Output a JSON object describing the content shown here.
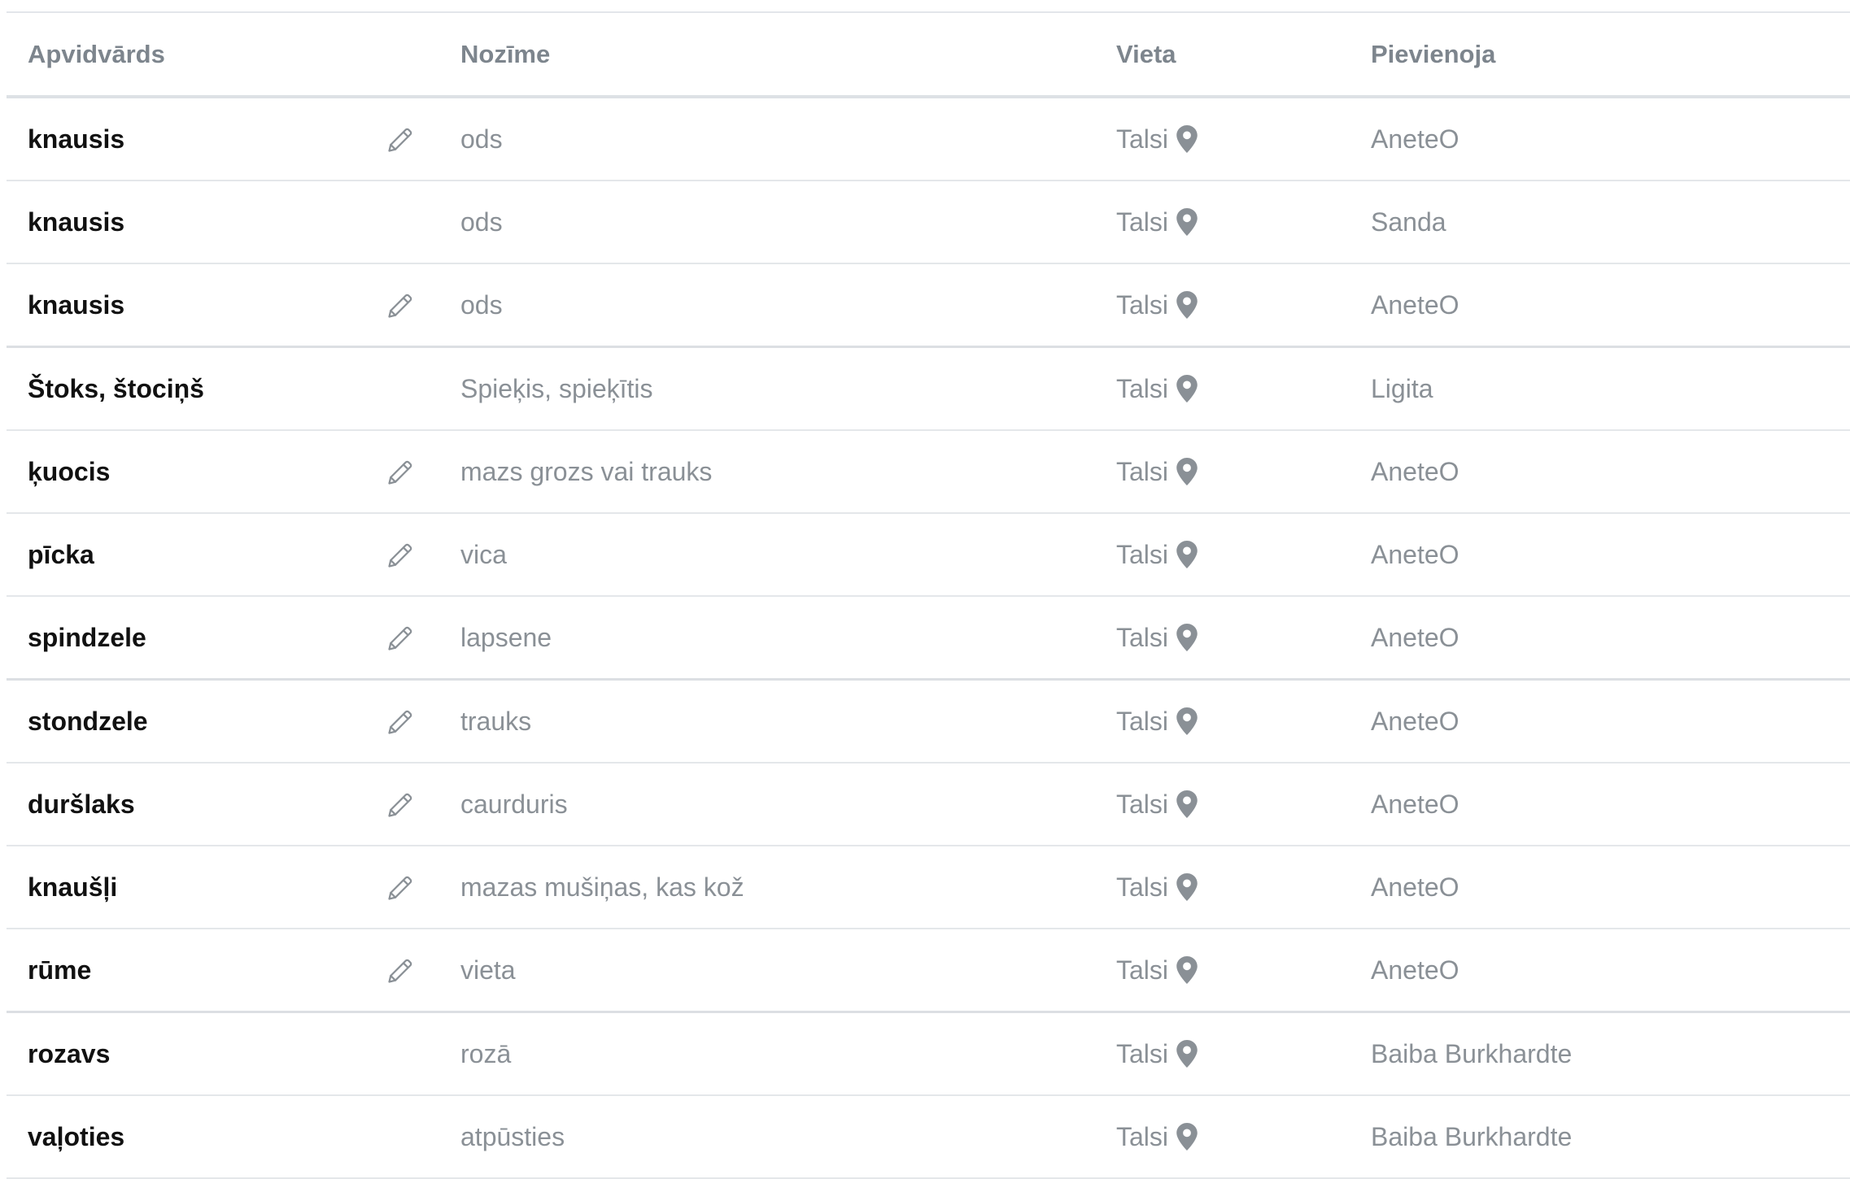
{
  "columns": {
    "word": "Apvidvārds",
    "meaning": "Nozīme",
    "place": "Vieta",
    "added_by": "Pievienoja"
  },
  "icons": {
    "edit": "pencil-icon",
    "place": "map-pin-icon"
  },
  "colors": {
    "header_text": "#7d858d",
    "word_text": "#111111",
    "muted_text": "#8a9096",
    "icon": "#8a9096"
  },
  "rows": [
    {
      "word": "knausis",
      "editable": true,
      "meaning": "ods",
      "place": "Talsi",
      "added_by": "AneteO"
    },
    {
      "word": "knausis",
      "editable": false,
      "meaning": "ods",
      "place": "Talsi",
      "added_by": "Sanda"
    },
    {
      "word": "knausis",
      "editable": true,
      "meaning": "ods",
      "place": "Talsi",
      "added_by": "AneteO"
    },
    {
      "word": "Štoks, štociņš",
      "editable": false,
      "meaning": "Spieķis, spieķītis",
      "place": "Talsi",
      "added_by": "Ligita"
    },
    {
      "word": "ķuocis",
      "editable": true,
      "meaning": "mazs grozs vai trauks",
      "place": "Talsi",
      "added_by": "AneteO"
    },
    {
      "word": "pīcka",
      "editable": true,
      "meaning": "vica",
      "place": "Talsi",
      "added_by": "AneteO"
    },
    {
      "word": "spindzele",
      "editable": true,
      "meaning": "lapsene",
      "place": "Talsi",
      "added_by": "AneteO"
    },
    {
      "word": "stondzele",
      "editable": true,
      "meaning": "trauks",
      "place": "Talsi",
      "added_by": "AneteO"
    },
    {
      "word": "duršlaks",
      "editable": true,
      "meaning": "caurduris",
      "place": "Talsi",
      "added_by": "AneteO"
    },
    {
      "word": "knaušļi",
      "editable": true,
      "meaning": "mazas mušiņas, kas kož",
      "place": "Talsi",
      "added_by": "AneteO"
    },
    {
      "word": "rūme",
      "editable": true,
      "meaning": "vieta",
      "place": "Talsi",
      "added_by": "AneteO"
    },
    {
      "word": "rozavs",
      "editable": false,
      "meaning": "rozā",
      "place": "Talsi",
      "added_by": "Baiba Burkhardte"
    },
    {
      "word": "vaļoties",
      "editable": false,
      "meaning": "atpūsties",
      "place": "Talsi",
      "added_by": "Baiba Burkhardte"
    }
  ]
}
